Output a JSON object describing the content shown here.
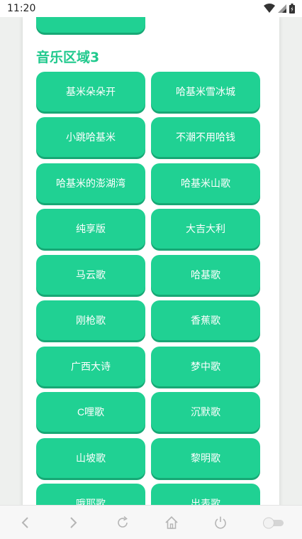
{
  "status_bar": {
    "time": "11:20",
    "icons": [
      "wifi-icon",
      "signal-icon",
      "battery-icon"
    ]
  },
  "section": {
    "title": "音乐区域3"
  },
  "buttons": [
    {
      "label": "基米朵朵开"
    },
    {
      "label": "哈基米雪冰城"
    },
    {
      "label": "小跳哈基米"
    },
    {
      "label": "不潮不用哈钱"
    },
    {
      "label": "哈基米的澎湖湾"
    },
    {
      "label": "哈基米山歌"
    },
    {
      "label": "纯享版"
    },
    {
      "label": "大吉大利"
    },
    {
      "label": "马云歌"
    },
    {
      "label": "哈基歌"
    },
    {
      "label": "刚枪歌"
    },
    {
      "label": "香蕉歌"
    },
    {
      "label": "广西大诗"
    },
    {
      "label": "梦中歌"
    },
    {
      "label": "C哩歌"
    },
    {
      "label": "沉默歌"
    },
    {
      "label": "山坡歌"
    },
    {
      "label": "黎明歌"
    },
    {
      "label": "哦耶歌"
    },
    {
      "label": "出表歌"
    }
  ],
  "nav_bar": {
    "icons": [
      "back-icon",
      "forward-icon",
      "reload-icon",
      "home-icon",
      "power-icon",
      "toggle-icon"
    ]
  },
  "colors": {
    "accent": "#20d193",
    "accent_shadow": "#17a875",
    "title": "#20c98d"
  }
}
